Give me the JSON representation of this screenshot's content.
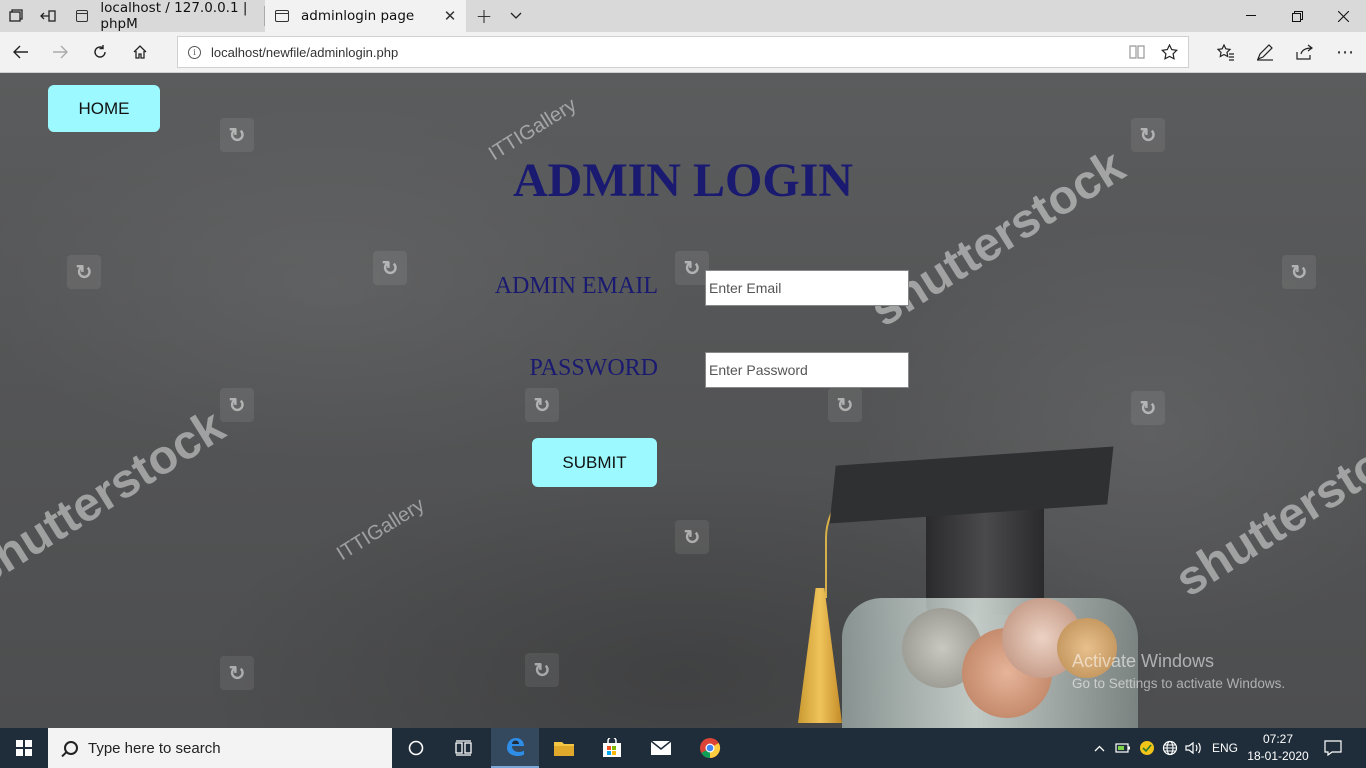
{
  "browser": {
    "tabs": [
      {
        "title": "localhost / 127.0.0.1 | phpM",
        "active": false
      },
      {
        "title": "adminlogin page",
        "active": true
      }
    ],
    "url": "localhost/newfile/adminlogin.php"
  },
  "page": {
    "home_label": "HOME",
    "title": "ADMIN LOGIN",
    "email_label": "ADMIN EMAIL",
    "email_placeholder": "Enter Email",
    "password_label": "PASSWORD",
    "password_placeholder": "Enter Password",
    "submit_label": "SUBMIT",
    "button_color": "#9cf9ff",
    "title_color": "#1a1a70"
  },
  "watermarks": {
    "brand": "shutterstock",
    "contributor": "ITTIGallery"
  },
  "activation": {
    "line1": "Activate Windows",
    "line2": "Go to Settings to activate Windows."
  },
  "taskbar": {
    "search_placeholder": "Type here to search",
    "language": "ENG",
    "time": "07:27",
    "date": "18-01-2020",
    "apps": [
      "cortana-icon",
      "task-view-icon",
      "edge-icon",
      "file-explorer-icon",
      "store-icon",
      "mail-icon",
      "chrome-icon"
    ]
  }
}
